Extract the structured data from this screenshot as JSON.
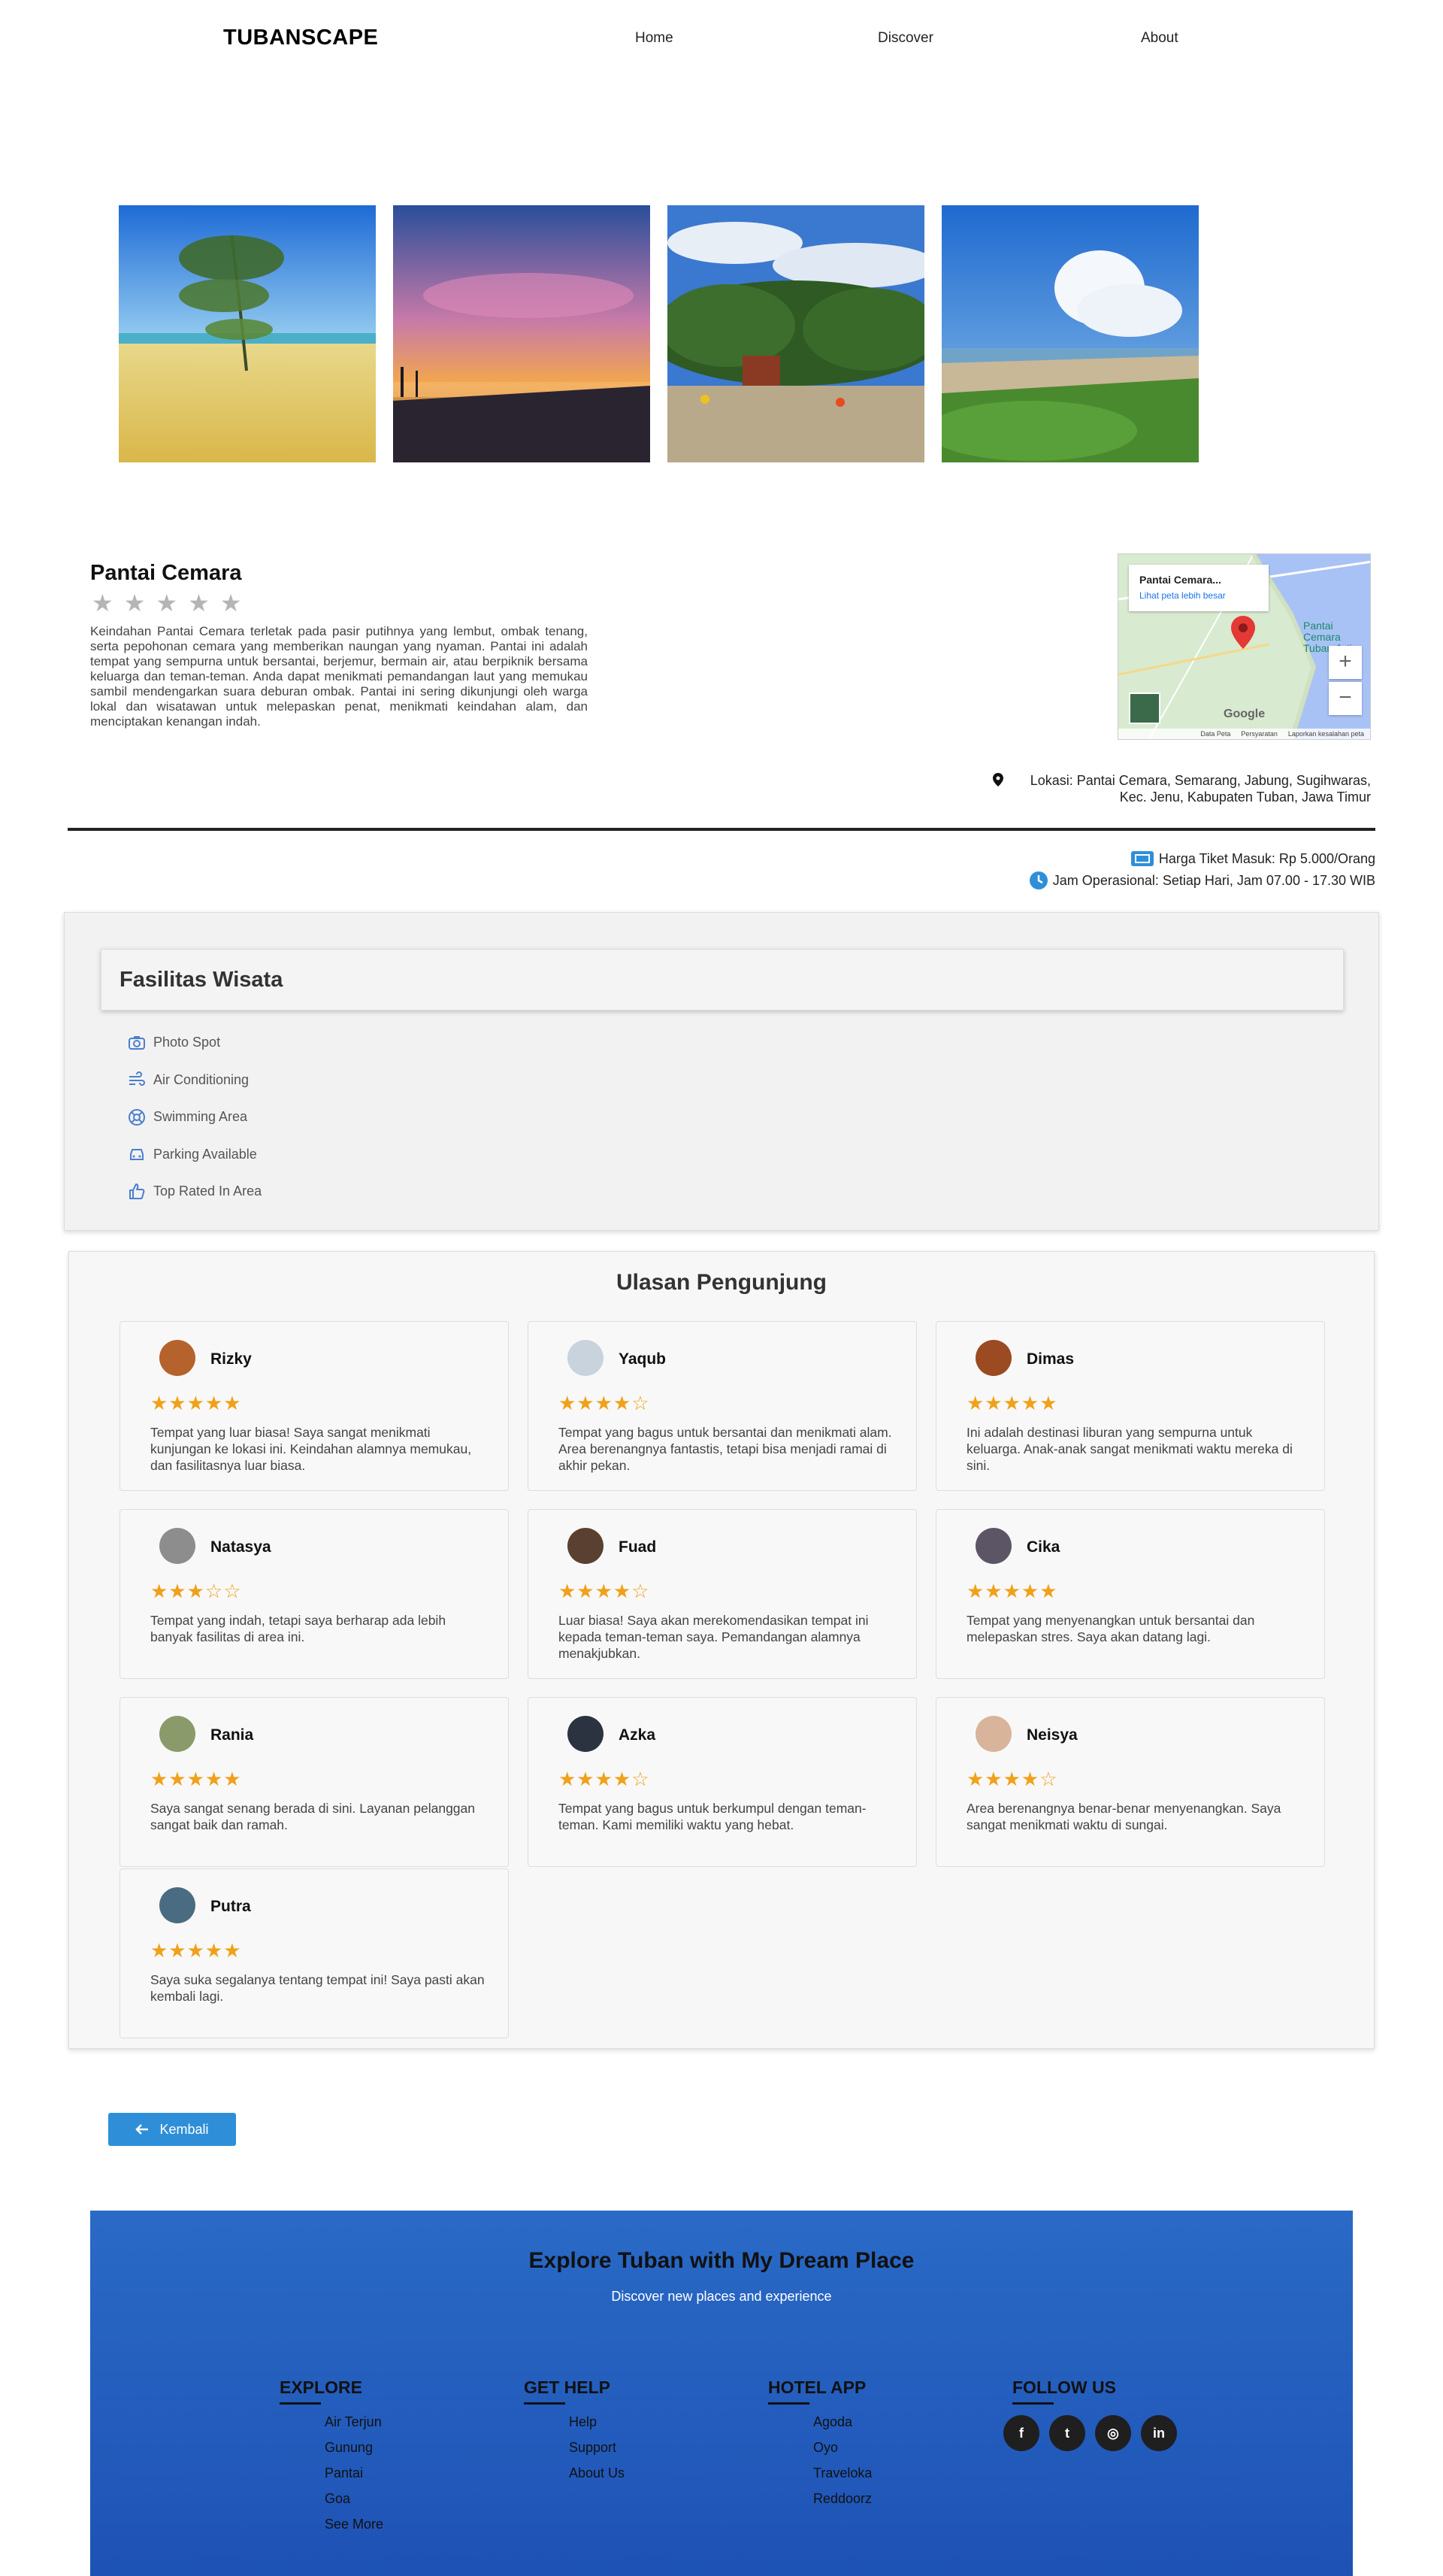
{
  "header": {
    "brand": "TUBANSCAPE",
    "nav": [
      "Home",
      "Discover",
      "About"
    ]
  },
  "place": {
    "title": "Pantai Cemara",
    "rating_stars": "★★★★★",
    "description": "Keindahan Pantai Cemara terletak pada pasir putihnya yang lembut, ombak tenang, serta pepohonan cemara yang memberikan naungan yang nyaman. Pantai ini adalah tempat yang sempurna untuk bersantai, berjemur, bermain air, atau berpiknik bersama keluarga dan teman-teman. Anda dapat menikmati pemandangan laut yang memukau sambil mendengarkan suara deburan ombak. Pantai ini sering dikunjungi oleh warga lokal dan wisatawan untuk melepaskan penat, menikmati keindahan alam, dan menciptakan kenangan indah.",
    "location": "Lokasi: Pantai Cemara, Semarang, Jabung, Sugihwaras, Kec. Jenu, Kabupaten Tuban, Jawa Timur",
    "ticket": "Harga Tiket Masuk: Rp 5.000/Orang",
    "hours": "Jam Operasional: Setiap Hari, Jam 07.00 - 17.30 WIB"
  },
  "map": {
    "card_title": "Pantai Cemara...",
    "card_link": "Lihat peta lebih besar",
    "place_label": "Pantai Cemara Tuban Jatim",
    "zoom_in": "+",
    "zoom_out": "−",
    "google": "Google",
    "footer": [
      "Data Peta",
      "Persyaratan",
      "Laporkan kesalahan peta"
    ]
  },
  "facilities": {
    "title": "Fasilitas Wisata",
    "items": [
      {
        "label": "Photo Spot",
        "icon": "camera-icon"
      },
      {
        "label": "Air Conditioning",
        "icon": "wind-icon"
      },
      {
        "label": "Swimming Area",
        "icon": "lifebuoy-icon"
      },
      {
        "label": "Parking Available",
        "icon": "car-icon"
      },
      {
        "label": "Top Rated In Area",
        "icon": "thumbs-up-icon"
      }
    ]
  },
  "reviews": {
    "title": "Ulasan Pengunjung",
    "items": [
      {
        "name": "Rizky",
        "stars": "★★★★★",
        "rating": 5,
        "text": "Tempat yang luar biasa! Saya sangat menikmati kunjungan ke lokasi ini. Keindahan alamnya memukau, dan fasilitasnya luar biasa.",
        "avatar": "#b5622c"
      },
      {
        "name": "Yaqub",
        "stars": "★★★★☆",
        "rating": 4,
        "text": "Tempat yang bagus untuk bersantai dan menikmati alam. Area berenangnya fantastis, tetapi bisa menjadi ramai di akhir pekan.",
        "avatar": "#c9d3de"
      },
      {
        "name": "Dimas",
        "stars": "★★★★★",
        "rating": 5,
        "text": "Ini adalah destinasi liburan yang sempurna untuk keluarga. Anak-anak sangat menikmati waktu mereka di sini.",
        "avatar": "#9b4a22"
      },
      {
        "name": "Natasya",
        "stars": "★★★☆☆",
        "rating": 3,
        "text": "Tempat yang indah, tetapi saya berharap ada lebih banyak fasilitas di area ini.",
        "avatar": "#8d8d8d"
      },
      {
        "name": "Fuad",
        "stars": "★★★★☆",
        "rating": 4,
        "text": "Luar biasa! Saya akan merekomendasikan tempat ini kepada teman-teman saya. Pemandangan alamnya menakjubkan.",
        "avatar": "#5a4030"
      },
      {
        "name": "Cika",
        "stars": "★★★★★",
        "rating": 5,
        "text": "Tempat yang menyenangkan untuk bersantai dan melepaskan stres. Saya akan datang lagi.",
        "avatar": "#5c5566"
      },
      {
        "name": "Rania",
        "stars": "★★★★★",
        "rating": 5,
        "text": "Saya sangat senang berada di sini. Layanan pelanggan sangat baik dan ramah.",
        "avatar": "#8a9a6a"
      },
      {
        "name": "Azka",
        "stars": "★★★★☆",
        "rating": 4,
        "text": "Tempat yang bagus untuk berkumpul dengan teman-teman. Kami memiliki waktu yang hebat.",
        "avatar": "#2b3340"
      },
      {
        "name": "Neisya",
        "stars": "★★★★☆",
        "rating": 4,
        "text": "Area berenangnya benar-benar menyenangkan. Saya sangat menikmati waktu di sungai.",
        "avatar": "#d8b49a"
      },
      {
        "name": "Putra",
        "stars": "★★★★★",
        "rating": 5,
        "text": "Saya suka segalanya tentang tempat ini! Saya pasti akan kembali lagi.",
        "avatar": "#4a6c82"
      }
    ]
  },
  "back_button": "Kembali",
  "footer": {
    "title": "Explore Tuban with My Dream Place",
    "subtitle": "Discover new places and experience",
    "columns": [
      {
        "heading": "EXPLORE",
        "links": [
          "Air Terjun",
          "Gunung",
          "Pantai",
          "Goa",
          "See More"
        ]
      },
      {
        "heading": "GET HELP",
        "links": [
          "Help",
          "Support",
          "About Us"
        ]
      },
      {
        "heading": "HOTEL APP",
        "links": [
          "Agoda",
          "Oyo",
          "Traveloka",
          "Reddoorz"
        ]
      }
    ],
    "follow": {
      "heading": "FOLLOW US",
      "socials": [
        {
          "glyph": "f",
          "icon": "facebook-icon"
        },
        {
          "glyph": "t",
          "icon": "twitter-icon"
        },
        {
          "glyph": "◎",
          "icon": "instagram-icon"
        },
        {
          "glyph": "in",
          "icon": "linkedin-icon"
        }
      ]
    }
  },
  "colors": {
    "accent": "#2e8fd8",
    "star_gold": "#f0a11a",
    "star_grey": "#b5b5b5",
    "footer_blue": "#2a6ac6"
  }
}
